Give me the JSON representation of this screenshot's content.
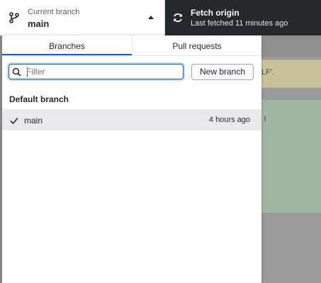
{
  "toolbar": {
    "current_branch_label": "Current branch",
    "current_branch": "main",
    "fetch_title": "Fetch origin",
    "fetch_subtitle": "Last fetched 11 minutes ago"
  },
  "background": {
    "banner_fragment": "LF'."
  },
  "dropdown": {
    "tabs": [
      {
        "label": "Branches",
        "selected": true
      },
      {
        "label": "Pull requests",
        "selected": false
      }
    ],
    "filter": {
      "value": "",
      "placeholder": "Filter"
    },
    "new_branch_label": "New branch",
    "section_heading": "Default branch",
    "branches": [
      {
        "name": "main",
        "time": "4 hours ago",
        "checked": true
      }
    ]
  },
  "icons": {
    "branch": "git-branch-icon",
    "fetch": "sync-icon",
    "filter": "search-icon",
    "check": "check-icon",
    "caret": "caret-up-icon"
  },
  "colors": {
    "toolbar_bg": "#24292e",
    "accent": "#0366d6",
    "selected_row": "#e8eaed"
  }
}
